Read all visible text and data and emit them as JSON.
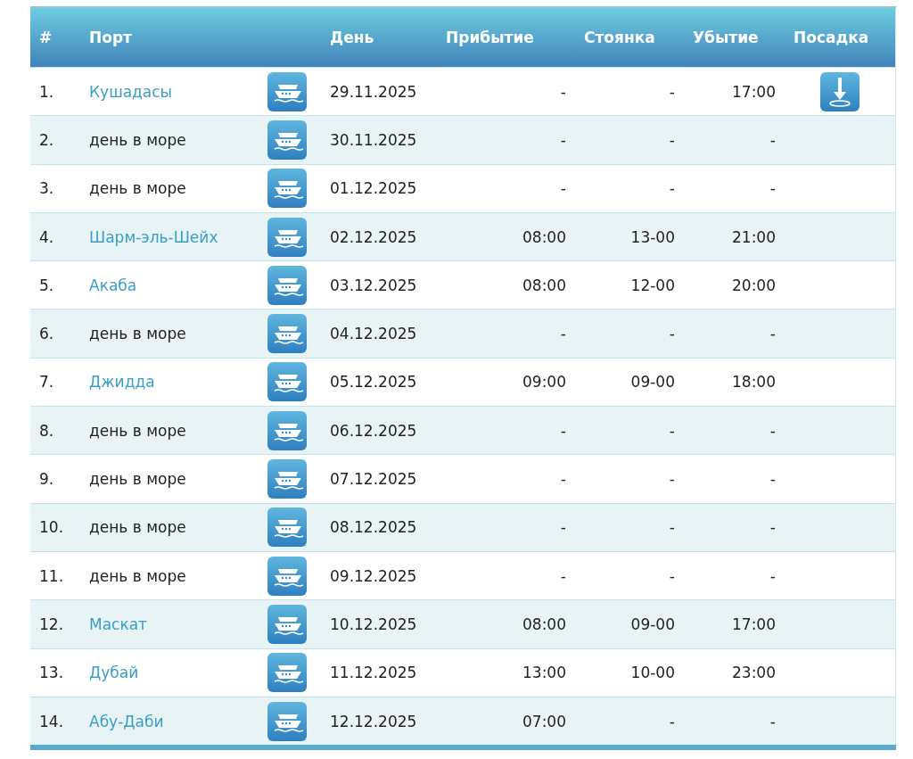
{
  "table": {
    "columns": [
      "#",
      "Порт",
      "День",
      "Прибытие",
      "Стоянка",
      "Убытие",
      "Посадка"
    ],
    "rows": [
      {
        "num": "1.",
        "port": "Кушадасы",
        "kind": "port",
        "day": "29.11.2025",
        "arrival": "-",
        "stop": "-",
        "departure": "17:00",
        "boarding": true
      },
      {
        "num": "2.",
        "port": "день в море",
        "kind": "sea",
        "day": "30.11.2025",
        "arrival": "-",
        "stop": "-",
        "departure": "-",
        "boarding": false
      },
      {
        "num": "3.",
        "port": "день в море",
        "kind": "sea",
        "day": "01.12.2025",
        "arrival": "-",
        "stop": "-",
        "departure": "-",
        "boarding": false
      },
      {
        "num": "4.",
        "port": "Шарм-эль-Шейх",
        "kind": "port",
        "day": "02.12.2025",
        "arrival": "08:00",
        "stop": "13-00",
        "departure": "21:00",
        "boarding": false
      },
      {
        "num": "5.",
        "port": "Акаба",
        "kind": "port",
        "day": "03.12.2025",
        "arrival": "08:00",
        "stop": "12-00",
        "departure": "20:00",
        "boarding": false
      },
      {
        "num": "6.",
        "port": "день в море",
        "kind": "sea",
        "day": "04.12.2025",
        "arrival": "-",
        "stop": "-",
        "departure": "-",
        "boarding": false
      },
      {
        "num": "7.",
        "port": "Джидда",
        "kind": "port",
        "day": "05.12.2025",
        "arrival": "09:00",
        "stop": "09-00",
        "departure": "18:00",
        "boarding": false
      },
      {
        "num": "8.",
        "port": "день в море",
        "kind": "sea",
        "day": "06.12.2025",
        "arrival": "-",
        "stop": "-",
        "departure": "-",
        "boarding": false
      },
      {
        "num": "9.",
        "port": "день в море",
        "kind": "sea",
        "day": "07.12.2025",
        "arrival": "-",
        "stop": "-",
        "departure": "-",
        "boarding": false
      },
      {
        "num": "10.",
        "port": "день в море",
        "kind": "sea",
        "day": "08.12.2025",
        "arrival": "-",
        "stop": "-",
        "departure": "-",
        "boarding": false
      },
      {
        "num": "11.",
        "port": "день в море",
        "kind": "sea",
        "day": "09.12.2025",
        "arrival": "-",
        "stop": "-",
        "departure": "-",
        "boarding": false
      },
      {
        "num": "12.",
        "port": "Маскат",
        "kind": "port",
        "day": "10.12.2025",
        "arrival": "08:00",
        "stop": "09-00",
        "departure": "17:00",
        "boarding": false
      },
      {
        "num": "13.",
        "port": "Дубай",
        "kind": "port",
        "day": "11.12.2025",
        "arrival": "13:00",
        "stop": "10-00",
        "departure": "23:00",
        "boarding": false
      },
      {
        "num": "14.",
        "port": "Абу-Даби",
        "kind": "port",
        "day": "12.12.2025",
        "arrival": "07:00",
        "stop": "-",
        "departure": "-",
        "boarding": false
      }
    ]
  }
}
